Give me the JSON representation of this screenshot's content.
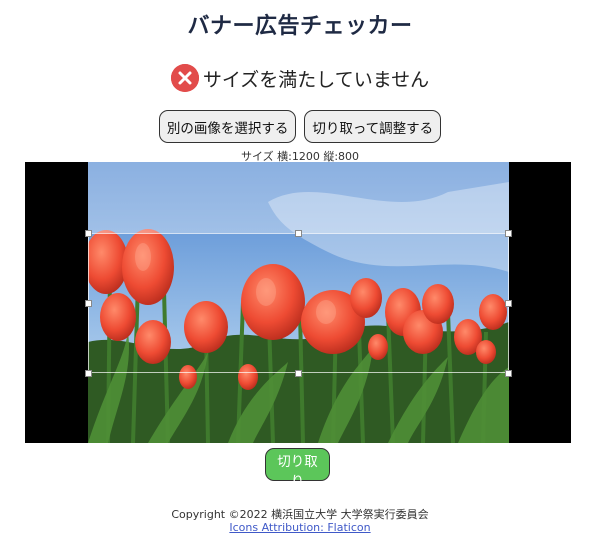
{
  "header": {
    "title": "バナー広告チェッカー"
  },
  "status": {
    "icon": "x-circle-icon",
    "message": "サイズを満たしていません",
    "color": "#e24c4b"
  },
  "actions": {
    "select_other_label": "別の画像を選択する",
    "crop_adjust_label": "切り取って調整する"
  },
  "image_info": {
    "size_text": "サイズ 横:1200 縦:800"
  },
  "cropper": {
    "image": "tulip-field-photo"
  },
  "crop_button": {
    "label": "切り取り",
    "color": "#5cc65a"
  },
  "footer": {
    "copyright": "Copyright ©2022 横浜国立大学 大学祭実行委員会",
    "attribution": "Icons Attribution: Flaticon"
  }
}
